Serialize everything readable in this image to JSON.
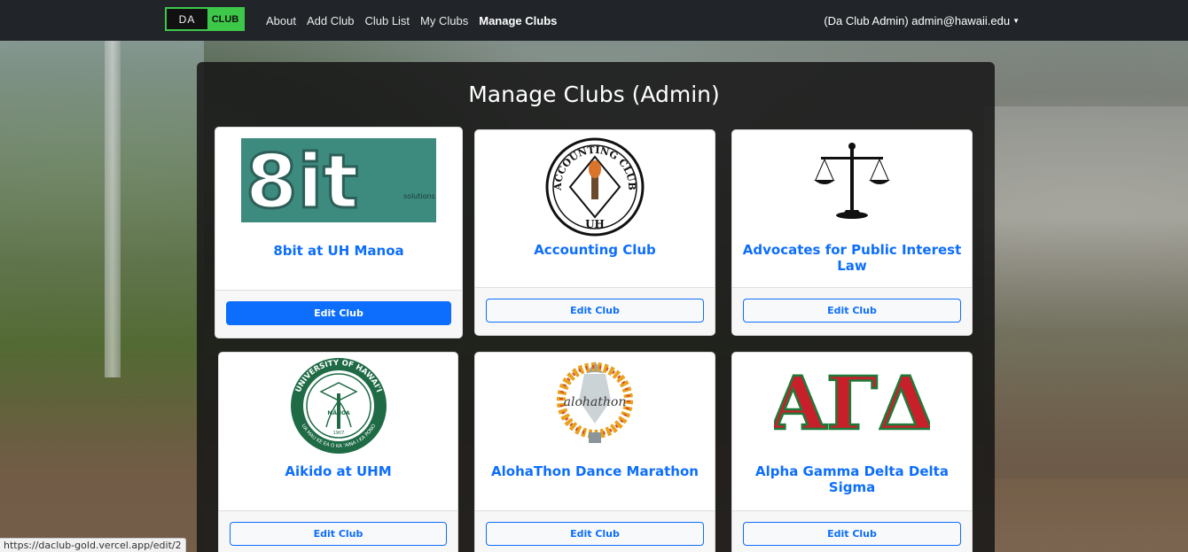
{
  "nav": {
    "brand_da": "DA",
    "brand_club": "CLUB",
    "links": [
      "About",
      "Add Club",
      "Club List",
      "My Clubs",
      "Manage Clubs"
    ],
    "active_link": "Manage Clubs",
    "user": "(Da Club Admin) admin@hawaii.edu"
  },
  "page": {
    "title": "Manage Clubs (Admin)"
  },
  "clubs": [
    {
      "name": "8bit at UH Manoa",
      "button": "Edit Club",
      "logo": "8bit-logo"
    },
    {
      "name": "Accounting Club",
      "button": "Edit Club",
      "logo": "accounting-club-seal"
    },
    {
      "name": "Advocates for Public Interest Law",
      "button": "Edit Club",
      "logo": "scales-of-justice"
    },
    {
      "name": "Aikido at UHM",
      "button": "Edit Club",
      "logo": "uh-seal"
    },
    {
      "name": "AlohaThon Dance Marathon",
      "button": "Edit Club",
      "logo": "alohathon-lei"
    },
    {
      "name": "Alpha Gamma Delta Delta Sigma",
      "button": "Edit Club",
      "logo": "agd-letters"
    }
  ],
  "logos": {
    "bit_text": "8it",
    "bit_small": "solutions",
    "seal_top": "ACCOUNTING CLUB",
    "seal_bottom": "UH",
    "uh_ring": "UNIVERSITY OF HAWAI'I",
    "uh_ring_bottom": "UA MAU KE EA O KA 'AINA I KA PONO",
    "uh_center": "MĀNOA",
    "uh_year": "1907",
    "alohathon": "alohathon",
    "agd": "ΑΓΔ"
  },
  "status_url": "https://daclub-gold.vercel.app/edit/2",
  "colors": {
    "navbar": "#212529",
    "brand_green": "#3ec84a",
    "link_blue": "#0d6efd",
    "bit_teal": "#3d8a7f",
    "agd_red": "#c8202a",
    "agd_green": "#1e7a3a",
    "uh_green": "#1f6b46"
  }
}
